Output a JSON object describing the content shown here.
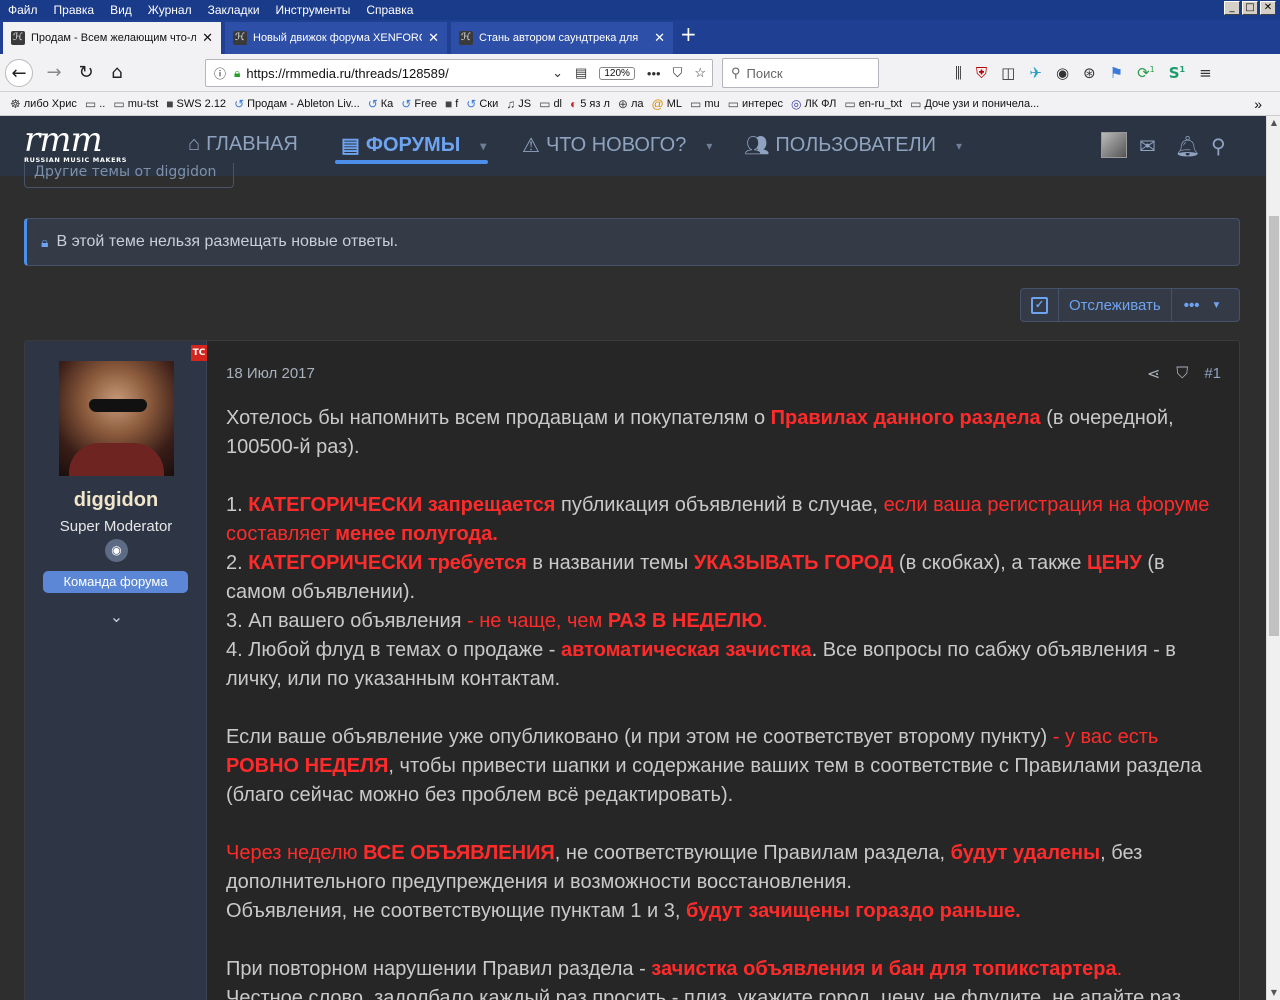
{
  "browser": {
    "menu": [
      "Файл",
      "Правка",
      "Вид",
      "Журнал",
      "Закладки",
      "Инструменты",
      "Справка"
    ],
    "tabs": [
      {
        "title": "Продам - Всем желающим что-ли"
      },
      {
        "title": "Новый движок форума XENFORO"
      },
      {
        "title": "Стань автором саундтрека для"
      }
    ],
    "url": "https://rmmedia.ru/threads/128589/",
    "zoom": "120%",
    "search_placeholder": "Поиск",
    "badge_1": "1",
    "badge_2": "1",
    "bookmarks": [
      "либо Хрис",
      "..",
      "mu-tst",
      "SWS 2.12",
      "Продам - Ableton Liv...",
      "Ка",
      "Free",
      "f",
      "Ски",
      "JS",
      "dl",
      "5 яз л",
      "ла",
      "ML",
      "mu",
      "интерес",
      "ЛК ФЛ",
      "en-ru_txt",
      "Доче узи и поничела..."
    ]
  },
  "site": {
    "logo_mark": "rmm",
    "logo_sub": "RUSSIAN MUSIC MAKERS",
    "nav": {
      "home": "ГЛАВНАЯ",
      "forums": "ФОРУМЫ",
      "whats_new": "ЧТО НОВОГО?",
      "members": "ПОЛЬЗОВАТЕЛИ"
    },
    "other_themes": "Другие темы от diggidon",
    "locked_notice": "В этой теме нельзя размещать новые ответы.",
    "watch_label": "Отслеживать",
    "watch_more": "•••"
  },
  "post": {
    "op_badge": "ТС",
    "username": "diggidon",
    "user_title": "Super Moderator",
    "team_badge": "Команда форума",
    "date": "18 Июл 2017",
    "number": "#1",
    "body": {
      "intro_a": "Хотелось бы напомнить всем продавцам и покупателям о ",
      "intro_b": "Правилах данного раздела",
      "intro_c": " (в очередной, 100500-й раз).",
      "r1_a": "1. ",
      "r1_b": "КАТЕГОРИЧЕСКИ запрещается",
      "r1_c": " публикация объявлений в случае, ",
      "r1_d": "если ваша регистрация на форуме составляет ",
      "r1_e": "менее полугода.",
      "r2_a": "2. ",
      "r2_b": "КАТЕГОРИЧЕСКИ требуется",
      "r2_c": " в названии темы ",
      "r2_d": "УКАЗЫВАТЬ ГОРОД",
      "r2_e": " (в скобках), а также ",
      "r2_f": "ЦЕНУ",
      "r2_g": " (в самом объявлении).",
      "r3_a": "3. Ап вашего объявления ",
      "r3_b": "- не чаще, чем ",
      "r3_c": "РАЗ В НЕДЕЛЮ",
      "r3_d": ".",
      "r4_a": "4. Любой флуд в темах о продаже - ",
      "r4_b": "автоматическая зачистка",
      "r4_c": ". Все вопросы по сабжу объявления - в личку, или по указанным контактам.",
      "p2_a": "Если ваше объявление уже опубликовано (и при этом не соответствует второму пункту) ",
      "p2_b": "- у вас есть ",
      "p2_c": "РОВНО НЕДЕЛЯ",
      "p2_d": ", чтобы привести шапки и содержание ваших тем в соответствие с Правилами раздела (благо сейчас можно без проблем всё редактировать).",
      "p3_a": "Через неделю ",
      "p3_b": "ВСЕ ОБЪЯВЛЕНИЯ",
      "p3_c": ", не соответствующие Правилам раздела, ",
      "p3_d": "будут удалены",
      "p3_e": ", без дополнительного предупреждения и возможности восстановления.",
      "p3_f": "Объявления, не соответствующие пунктам 1 и 3, ",
      "p3_g": "будут зачищены гораздо раньше.",
      "p4_a": "При повторном нарушении Правил раздела - ",
      "p4_b": "зачистка объявления и бан для топикстартера",
      "p4_c": ".",
      "p4_d": "Честное слово, задолбало каждый раз просить - плиз, укажите город, цену, не флудите, не апайте раз"
    }
  },
  "colors": {
    "header_bg": "#2b3442",
    "accent": "#4b8fea",
    "warning_red": "#ff2b2b",
    "tab_bar": "#1e3f92"
  }
}
